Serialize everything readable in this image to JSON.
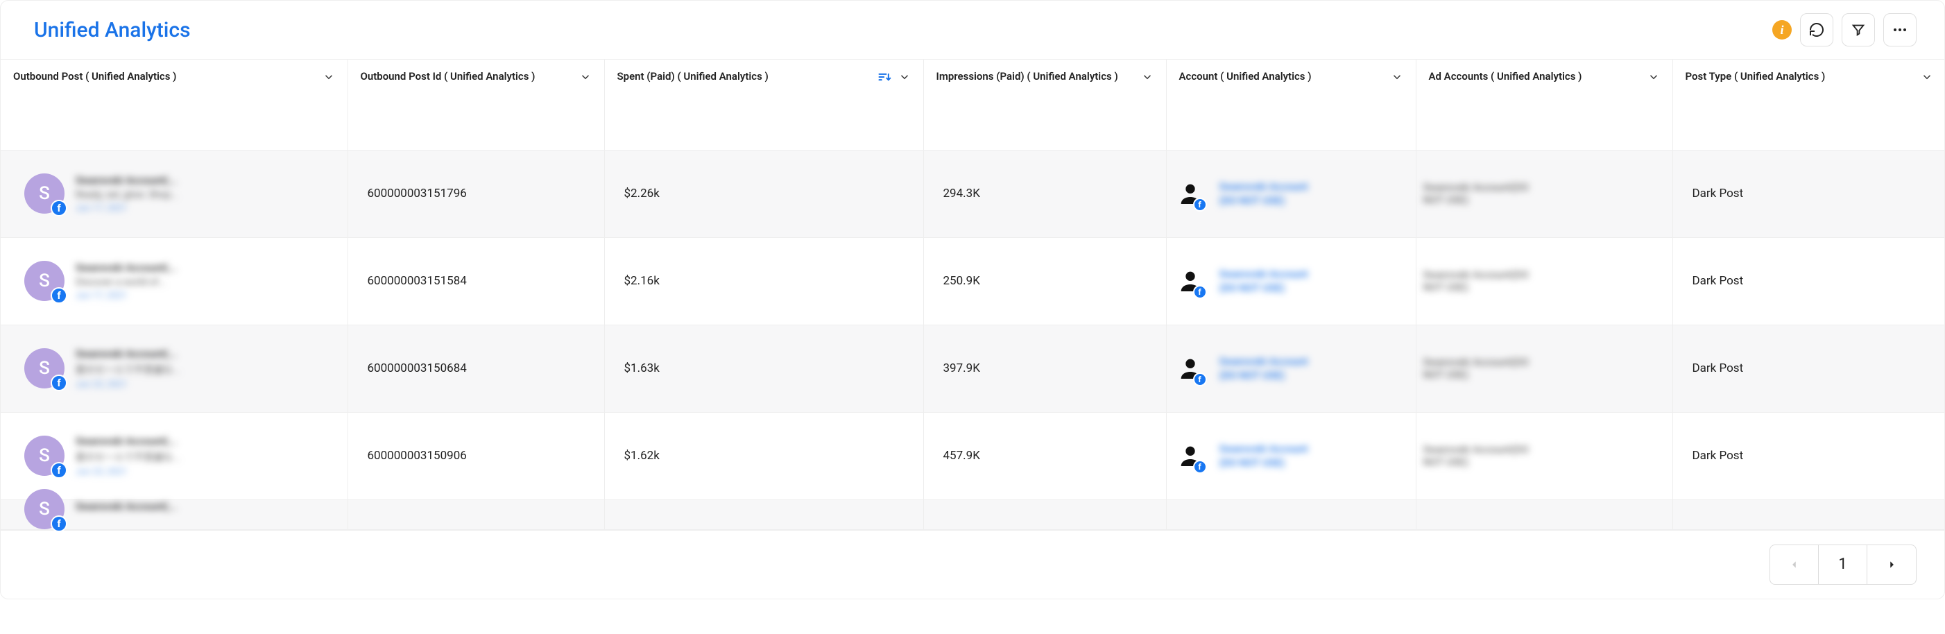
{
  "header": {
    "title": "Unified Analytics",
    "info_tooltip": "i"
  },
  "columns": {
    "outbound_post": "Outbound Post ( Unified Analytics )",
    "outbound_post_id": "Outbound Post Id ( Unified Analytics )",
    "spent": "Spent (Paid) ( Unified Analytics )",
    "impressions": "Impressions (Paid) ( Unified Analytics )",
    "account": "Account ( Unified Analytics )",
    "ad_accounts": "Ad Accounts ( Unified Analytics )",
    "post_type": "Post Type ( Unified Analytics )"
  },
  "rows": [
    {
      "avatar_letter": "S",
      "post_title": "Swarovski Account(...",
      "post_sub": "Ready, set, glow. Shop...",
      "post_date": "Jun 17, 2021",
      "post_id": "600000003151796",
      "spent": "$2.26k",
      "impressions": "294.3K",
      "account_line1": "Swarovski Account",
      "account_line2": "(DO NOT USE)",
      "ad_account_line1": "Swarovski Account(DO",
      "ad_account_line2": "NOT USE)",
      "post_type": "Dark Post"
    },
    {
      "avatar_letter": "S",
      "post_title": "Swarovski Account(...",
      "post_sub": "Discover a world of...",
      "post_date": "Jun 17, 2021",
      "post_id": "600000003151584",
      "spent": "$2.16k",
      "impressions": "250.9K",
      "account_line1": "Swarovski Account",
      "account_line2": "(DO NOT USE)",
      "ad_account_line1": "Swarovski Account(DO",
      "ad_account_line2": "NOT USE)",
      "post_type": "Dark Post"
    },
    {
      "avatar_letter": "S",
      "post_title": "Swarovski Account(...",
      "post_sub": "夏のセールで不思議な...",
      "post_date": "Jun 23, 2021",
      "post_id": "600000003150684",
      "spent": "$1.63k",
      "impressions": "397.9K",
      "account_line1": "Swarovski Account",
      "account_line2": "(DO NOT USE)",
      "ad_account_line1": "Swarovski Account(DO",
      "ad_account_line2": "NOT USE)",
      "post_type": "Dark Post"
    },
    {
      "avatar_letter": "S",
      "post_title": "Swarovski Account(...",
      "post_sub": "夏のセールで不思議な...",
      "post_date": "Jun 23, 2021",
      "post_id": "600000003150906",
      "spent": "$1.62k",
      "impressions": "457.9K",
      "account_line1": "Swarovski Account",
      "account_line2": "(DO NOT USE)",
      "ad_account_line1": "Swarovski Account(DO",
      "ad_account_line2": "NOT USE)",
      "post_type": "Dark Post"
    },
    {
      "avatar_letter": "S",
      "post_title": "Swarovski Account(...",
      "post_sub": "",
      "post_date": "",
      "post_id": "",
      "spent": "",
      "impressions": "",
      "account_line1": "",
      "account_line2": "",
      "ad_account_line1": "",
      "ad_account_line2": "",
      "post_type": ""
    }
  ],
  "pager": {
    "page": "1"
  }
}
